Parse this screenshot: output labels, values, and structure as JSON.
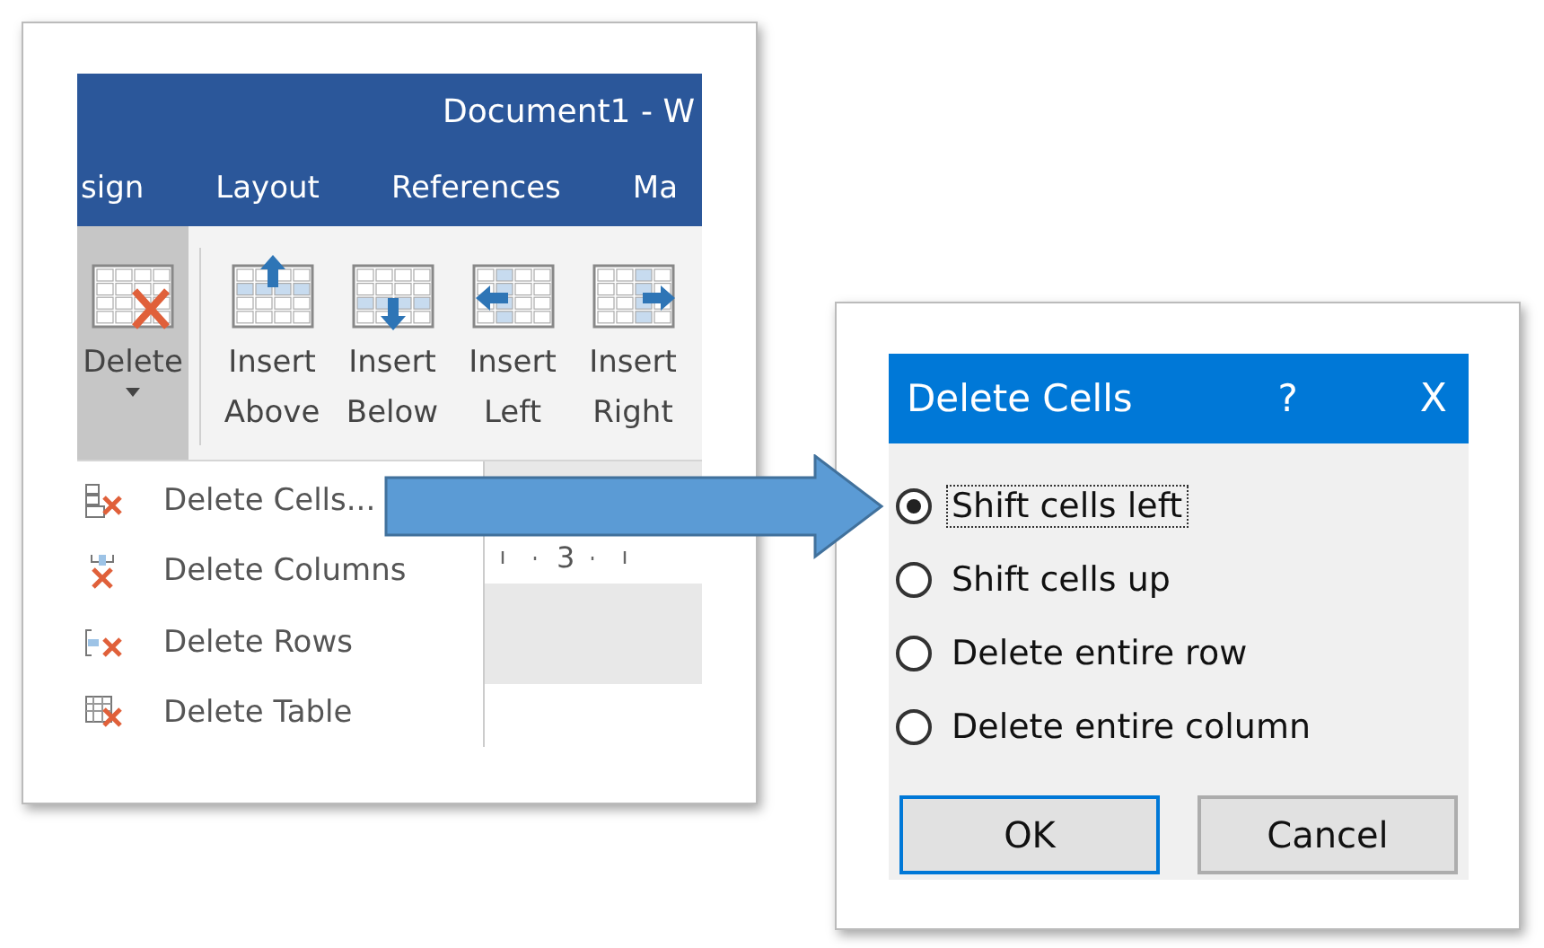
{
  "word": {
    "title": "Document1 - W",
    "tabs": [
      {
        "label": "sign",
        "selected": false
      },
      {
        "label": "Layout",
        "selected": false
      },
      {
        "label": "References",
        "selected": false
      },
      {
        "label": "Ma",
        "selected": false
      }
    ],
    "ribbon": [
      {
        "label": "Delete",
        "kind": "delete",
        "selected": true
      },
      {
        "label": "Insert Above",
        "kind": "above",
        "selected": false
      },
      {
        "label": "Insert Below",
        "kind": "below",
        "selected": false
      },
      {
        "label": "Insert Left",
        "kind": "left",
        "selected": false
      },
      {
        "label": "Insert Right",
        "kind": "right",
        "selected": false
      }
    ],
    "menu": [
      {
        "label": "Delete Cells...",
        "kind": "cells"
      },
      {
        "label": "Delete Columns",
        "kind": "columns"
      },
      {
        "label": "Delete Rows",
        "kind": "rows"
      },
      {
        "label": "Delete Table",
        "kind": "table"
      }
    ],
    "ruler": {
      "label": "3"
    }
  },
  "dialog": {
    "title": "Delete Cells",
    "help": "?",
    "close": "X",
    "options": [
      {
        "label": "Shift cells left",
        "selected": true
      },
      {
        "label": "Shift cells up",
        "selected": false
      },
      {
        "label": "Delete entire row",
        "selected": false
      },
      {
        "label": "Delete entire column",
        "selected": false
      }
    ],
    "buttons": [
      {
        "label": "OK",
        "default": true
      },
      {
        "label": "Cancel",
        "default": false
      }
    ]
  }
}
